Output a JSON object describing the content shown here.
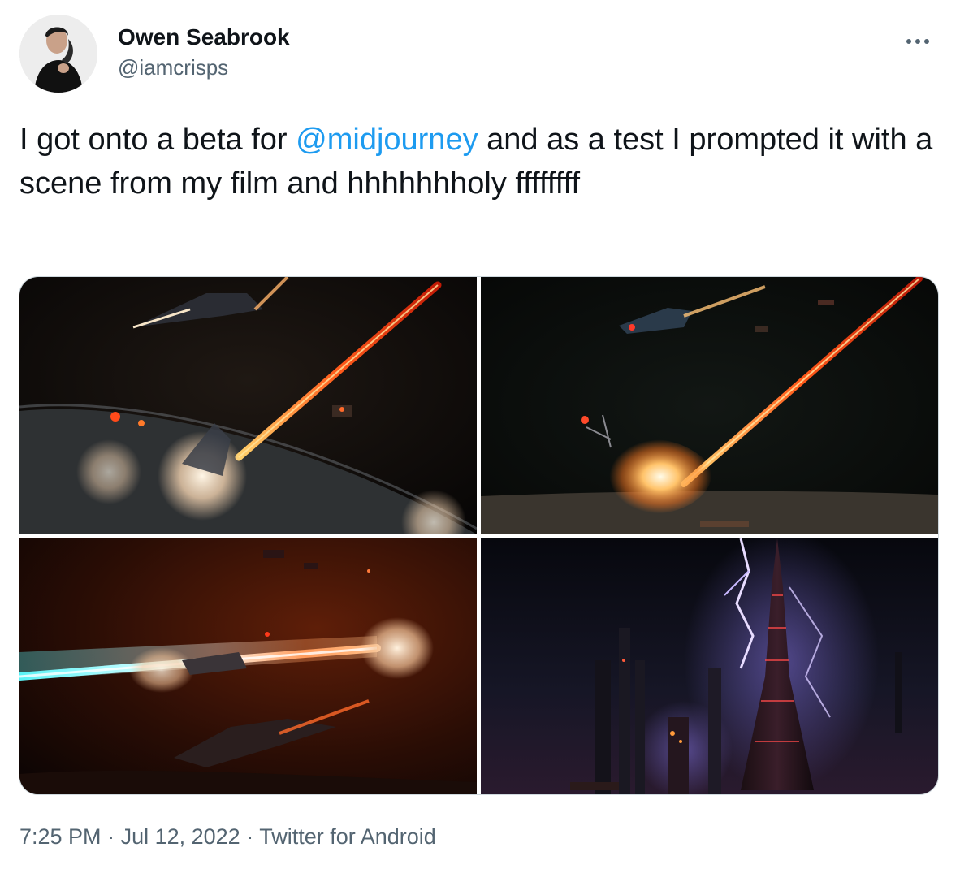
{
  "author": {
    "display_name": "Owen Seabrook",
    "handle": "@iamcrisps"
  },
  "more_icon": "more-horizontal-icon",
  "tweet": {
    "text_before": "I got onto a beta for ",
    "mention": "@midjourney",
    "text_after": " and as a test I prompted it with a scene from my film and hhhhhhholy ffffffff"
  },
  "media": {
    "images": [
      "space-battle-laser-planet",
      "space-battle-laser-explosion",
      "space-battle-cyan-orange-beam",
      "city-spire-lightning"
    ]
  },
  "meta": {
    "time": "7:25 PM",
    "separator": " · ",
    "date": "Jul 12, 2022",
    "source": "Twitter for Android"
  },
  "colors": {
    "link": "#1d9bf0",
    "secondary_text": "#536471",
    "primary_text": "#0f1419",
    "border": "#cfd9de"
  }
}
